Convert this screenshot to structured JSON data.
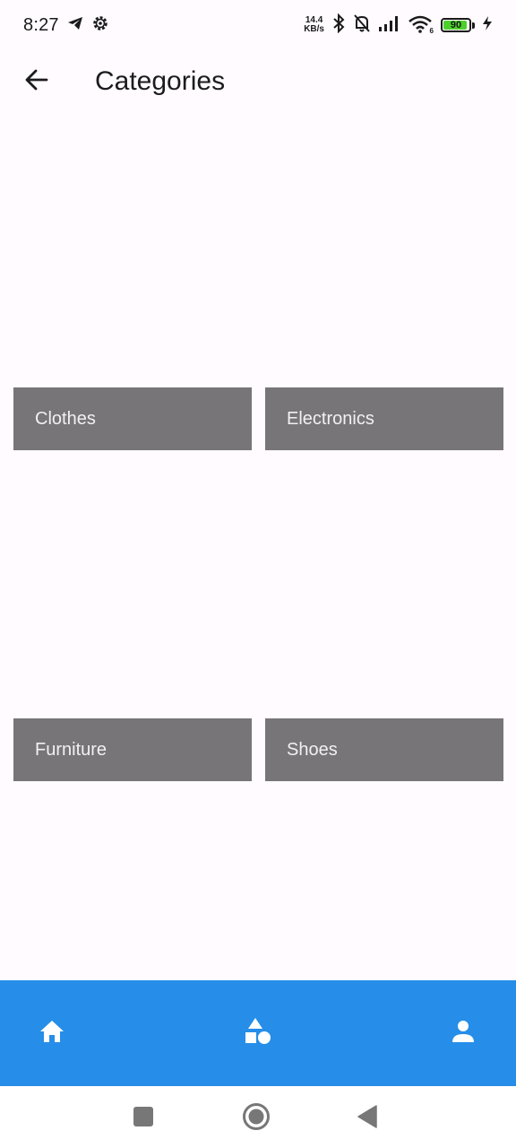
{
  "status_bar": {
    "time": "8:27",
    "net_speed_value": "14.4",
    "net_speed_unit": "KB/s",
    "wifi_badge": "6",
    "battery_level": "90",
    "icons": [
      "telegram-icon",
      "settings-gear-icon",
      "bluetooth-icon",
      "bell-muted-icon",
      "signal-icon",
      "wifi-icon",
      "battery-icon",
      "charging-icon"
    ]
  },
  "app_bar": {
    "title": "Categories",
    "back_icon": "arrow-back-icon"
  },
  "categories": [
    {
      "label": "Clothes"
    },
    {
      "label": "Electronics"
    },
    {
      "label": "Furniture"
    },
    {
      "label": "Shoes"
    }
  ],
  "bottom_nav": {
    "items": [
      {
        "icon": "home-icon"
      },
      {
        "icon": "categories-icon"
      },
      {
        "icon": "person-icon"
      }
    ],
    "background": "#268ee8"
  },
  "system_nav": {
    "items": [
      {
        "icon": "recents-square-icon"
      },
      {
        "icon": "home-circle-icon"
      },
      {
        "icon": "back-triangle-icon"
      }
    ]
  },
  "colors": {
    "background": "#fffbfe",
    "tile": "#777577",
    "tile_text": "#f3eff4",
    "accent": "#268ee8"
  }
}
